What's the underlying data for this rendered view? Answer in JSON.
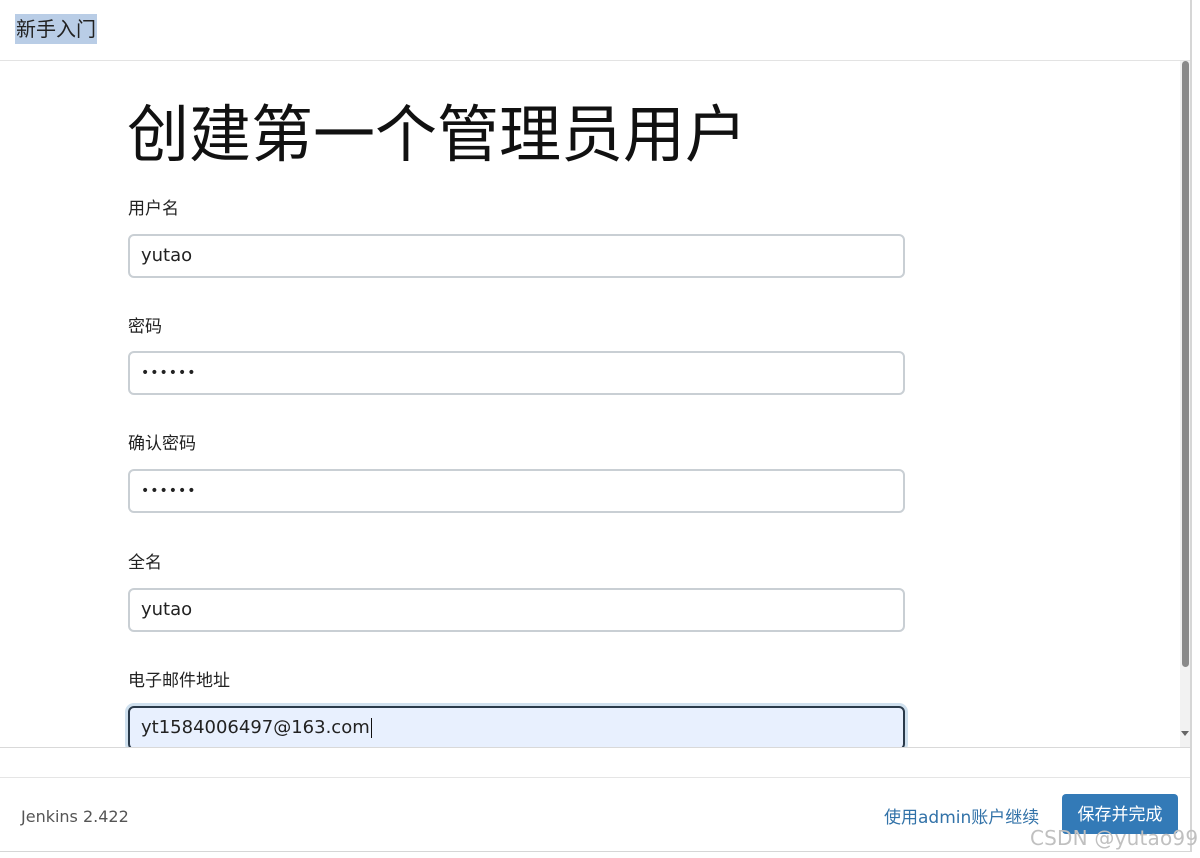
{
  "header": {
    "title": "新手入门"
  },
  "page": {
    "heading": "创建第一个管理员用户"
  },
  "form": {
    "username": {
      "label": "用户名",
      "value": "yutao"
    },
    "password": {
      "label": "密码",
      "value": "••••••"
    },
    "confirm_password": {
      "label": "确认密码",
      "value": "••••••"
    },
    "full_name": {
      "label": "全名",
      "value": "yutao"
    },
    "email": {
      "label": "电子邮件地址",
      "value": "yt1584006497@163.com"
    }
  },
  "footer": {
    "version": "Jenkins 2.422",
    "continue_link": "使用admin账户继续",
    "save_button": "保存并完成"
  },
  "watermark": "CSDN @yutao99",
  "colors": {
    "accent": "#337ab7",
    "link": "#3272a8",
    "focus_bg": "#e8f0fe",
    "selection": "#b9cde6"
  }
}
